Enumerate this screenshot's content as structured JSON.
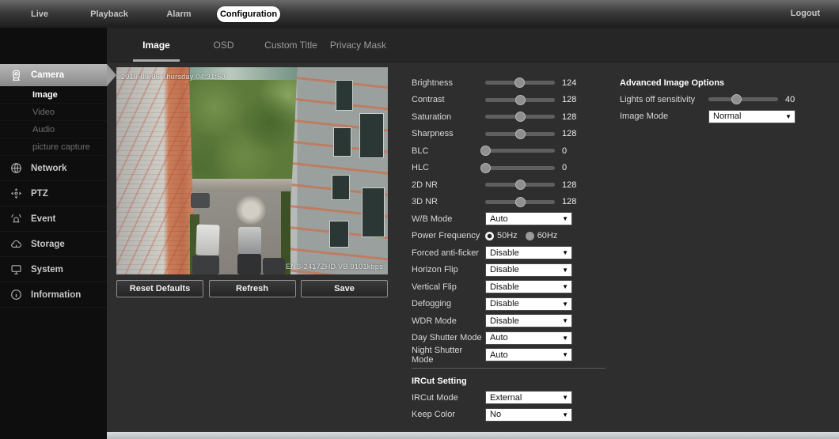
{
  "topbar": {
    "nav": [
      {
        "label": "Live",
        "active": false
      },
      {
        "label": "Playback",
        "active": false
      },
      {
        "label": "Alarm",
        "active": false
      },
      {
        "label": "Configuration",
        "active": true
      }
    ],
    "logout_label": "Logout"
  },
  "sidebar": {
    "items": [
      {
        "label": "Camera",
        "icon": "camera-icon",
        "selected": true,
        "children": [
          {
            "label": "Image",
            "active": true
          },
          {
            "label": "Video",
            "active": false
          },
          {
            "label": "Audio",
            "active": false
          },
          {
            "label": "picture capture",
            "active": false
          }
        ]
      },
      {
        "label": "Network",
        "icon": "network-icon",
        "selected": false
      },
      {
        "label": "PTZ",
        "icon": "ptz-icon",
        "selected": false
      },
      {
        "label": "Event",
        "icon": "event-icon",
        "selected": false
      },
      {
        "label": "Storage",
        "icon": "storage-icon",
        "selected": false
      },
      {
        "label": "System",
        "icon": "system-icon",
        "selected": false
      },
      {
        "label": "Information",
        "icon": "information-icon",
        "selected": false
      }
    ]
  },
  "tabs": {
    "items": [
      {
        "label": "Image",
        "active": true
      },
      {
        "label": "OSD",
        "active": false
      },
      {
        "label": "Custom Title",
        "active": false
      },
      {
        "label": "Privacy Mask",
        "active": false
      }
    ]
  },
  "preview": {
    "timestamp": "2019-09-06 Thursday 04:31:50",
    "camera_label": "ENS-2417ZHD VB 9101kbps"
  },
  "buttons": {
    "reset": "Reset Defaults",
    "refresh": "Refresh",
    "save": "Save"
  },
  "image_settings": {
    "controls": [
      {
        "type": "slider",
        "label": "Brightness",
        "value": 124,
        "max": 255
      },
      {
        "type": "slider",
        "label": "Contrast",
        "value": 128,
        "max": 255
      },
      {
        "type": "slider",
        "label": "Saturation",
        "value": 128,
        "max": 255
      },
      {
        "type": "slider",
        "label": "Sharpness",
        "value": 128,
        "max": 255
      },
      {
        "type": "slider",
        "label": "BLC",
        "value": 0,
        "max": 255
      },
      {
        "type": "slider",
        "label": "HLC",
        "value": 0,
        "max": 255
      },
      {
        "type": "slider",
        "label": "2D NR",
        "value": 128,
        "max": 255
      },
      {
        "type": "slider",
        "label": "3D NR",
        "value": 128,
        "max": 255
      },
      {
        "type": "select",
        "label": "W/B Mode",
        "value": "Auto"
      },
      {
        "type": "radio",
        "label": "Power Frequency",
        "options": [
          "50Hz",
          "60Hz"
        ],
        "selected": "50Hz"
      },
      {
        "type": "select",
        "label": "Forced anti-ficker",
        "value": "Disable"
      },
      {
        "type": "select",
        "label": "Horizon Flip",
        "value": "Disable"
      },
      {
        "type": "select",
        "label": "Vertical Flip",
        "value": "Disable"
      },
      {
        "type": "select",
        "label": "Defogging",
        "value": "Disable"
      },
      {
        "type": "select",
        "label": "WDR Mode",
        "value": "Disable"
      },
      {
        "type": "select",
        "label": "Day Shutter Mode",
        "value": "Auto"
      },
      {
        "type": "select",
        "label": "Night Shutter Mode",
        "value": "Auto"
      }
    ]
  },
  "ircut": {
    "heading": "IRCut Setting",
    "controls": [
      {
        "type": "select",
        "label": "IRCut Mode",
        "value": "External"
      },
      {
        "type": "select",
        "label": "Keep Color",
        "value": "No"
      }
    ]
  },
  "advanced": {
    "heading": "Advanced Image Options",
    "controls": [
      {
        "type": "slider",
        "label": "Lights off sensitivity",
        "value": 40,
        "max": 100
      },
      {
        "type": "select",
        "label": "Image Mode",
        "value": "Normal"
      }
    ]
  },
  "colors": {
    "content_bg": "#2e2e2e",
    "sidebar_bg": "#0e0e0e",
    "selected_highlight": "#9d9d9d",
    "select_bg": "#ffffff",
    "active_pill_bg": "#ffffff",
    "active_pill_text": "#000000"
  }
}
